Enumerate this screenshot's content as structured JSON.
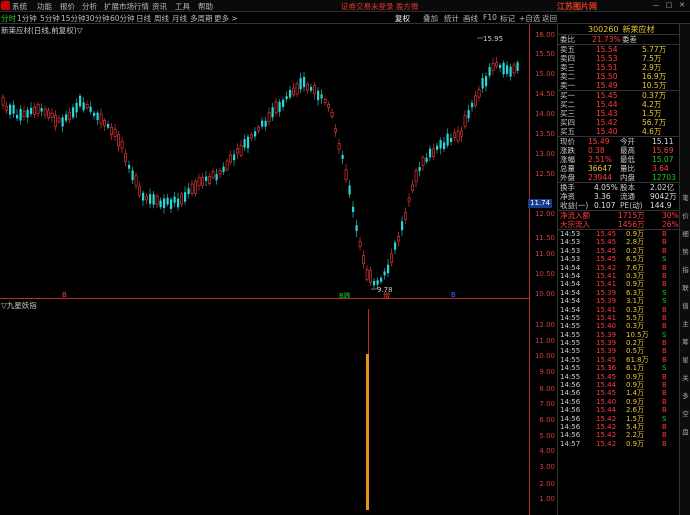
{
  "menu": {
    "items": [
      "系统",
      "功能",
      "报价",
      "分析",
      "扩展市场行情",
      "资讯",
      "工具",
      "帮助"
    ],
    "notice": "证券交易未登录  盈方微",
    "brand": "江苏图片网",
    "window_controls": [
      "—",
      "□",
      "✕"
    ]
  },
  "period_tabs": {
    "items": [
      "分时",
      "1分钟",
      "5分钟",
      "15分钟",
      "30分钟",
      "60分钟",
      "日线",
      "周线",
      "月线",
      "多周期",
      "更多 >"
    ],
    "active_index": 0
  },
  "toolbar": {
    "items": [
      "复权",
      "叠加",
      "统计",
      "画线",
      "F10",
      "标记",
      "+自选",
      "返回"
    ]
  },
  "chart": {
    "title": "新莱应材(日线,前复权)▽",
    "high_label": "15.95",
    "low_label": "9.78",
    "current_price_label": "11.74",
    "markers": [
      {
        "text": "B",
        "color": "#ff3b3b"
      },
      {
        "text": "B跌",
        "color": "#16d016"
      },
      {
        "text": "增",
        "color": "#ff3b3b"
      },
      {
        "text": "B",
        "color": "#3a6cff"
      }
    ]
  },
  "axis": {
    "price_labels": [
      "16.00",
      "15.50",
      "15.00",
      "14.50",
      "14.00",
      "13.50",
      "13.00",
      "12.50",
      "12.00",
      "11.50",
      "11.00",
      "10.50",
      "10.00"
    ],
    "ind_labels": [
      "12.00",
      "11.00",
      "10.00",
      "9.00",
      "8.00",
      "7.00",
      "6.00",
      "5.00",
      "4.00",
      "3.00",
      "2.00",
      "1.00"
    ]
  },
  "indicator": {
    "title": "▽九星妖指"
  },
  "stock": {
    "code": "300260",
    "name": "新莱应材"
  },
  "order_book": {
    "weibi": {
      "label": "委比",
      "value": "21.73%",
      "label2": "委差",
      "value2": ""
    },
    "asks": [
      {
        "label": "卖五",
        "price": "15.54",
        "vol": "5.77万"
      },
      {
        "label": "卖四",
        "price": "15.53",
        "vol": "7.5万"
      },
      {
        "label": "卖三",
        "price": "15.51",
        "vol": "2.9万"
      },
      {
        "label": "卖二",
        "price": "15.50",
        "vol": "16.9万"
      },
      {
        "label": "卖一",
        "price": "15.49",
        "vol": "10.5万"
      }
    ],
    "bids": [
      {
        "label": "买一",
        "price": "15.45",
        "vol": "0.37万"
      },
      {
        "label": "买二",
        "price": "15.44",
        "vol": "4.2万"
      },
      {
        "label": "买三",
        "price": "15.43",
        "vol": "1.5万"
      },
      {
        "label": "买四",
        "price": "15.42",
        "vol": "56.7万"
      },
      {
        "label": "买五",
        "price": "15.40",
        "vol": "4.6万"
      }
    ]
  },
  "quote": [
    {
      "l1": "现价",
      "v1": "15.49",
      "c1": "red",
      "l2": "今开",
      "v2": "15.11",
      "c2": "wht"
    },
    {
      "l1": "涨跌",
      "v1": "0.38",
      "c1": "red",
      "l2": "最高",
      "v2": "15.69",
      "c2": "red"
    },
    {
      "l1": "涨幅",
      "v1": "2.51%",
      "c1": "red",
      "l2": "最低",
      "v2": "15.07",
      "c2": "grn"
    },
    {
      "l1": "总量",
      "v1": "36647",
      "c1": "yel",
      "l2": "量比",
      "v2": "3.64",
      "c2": "red"
    },
    {
      "l1": "外盘",
      "v1": "23944",
      "c1": "red",
      "l2": "内盘",
      "v2": "12703",
      "c2": "grn"
    }
  ],
  "stats": [
    {
      "l1": "换手",
      "v1": "4.05%",
      "c1": "wht",
      "l2": "股本",
      "v2": "2.02亿",
      "c2": "wht"
    },
    {
      "l1": "净资",
      "v1": "3.36",
      "c1": "wht",
      "l2": "流通",
      "v2": "9042万",
      "c2": "wht"
    },
    {
      "l1": "收益(一)",
      "v1": "0.107",
      "c1": "wht",
      "l2": "PE(动)",
      "v2": "144.9",
      "c2": "wht"
    }
  ],
  "flows": [
    {
      "label": "净流入额",
      "value": "1715万",
      "pct": "30%"
    },
    {
      "label": "大宗流入",
      "value": "1456万",
      "pct": "26%"
    }
  ],
  "ticks": [
    {
      "t": "14:53",
      "p": "15.45",
      "v": "0.9万",
      "d": "B"
    },
    {
      "t": "14:53",
      "p": "15.45",
      "v": "2.8万",
      "d": "B"
    },
    {
      "t": "14:53",
      "p": "15.45",
      "v": "0.2万",
      "d": "B"
    },
    {
      "t": "14:53",
      "p": "15.45",
      "v": "6.5万",
      "d": "S"
    },
    {
      "t": "14:54",
      "p": "15.42",
      "v": "7.6万",
      "d": "B"
    },
    {
      "t": "14:54",
      "p": "15.41",
      "v": "0.3万",
      "d": "B"
    },
    {
      "t": "14:54",
      "p": "15.41",
      "v": "0.9万",
      "d": "B"
    },
    {
      "t": "14:54",
      "p": "15.39",
      "v": "6.3万",
      "d": "S"
    },
    {
      "t": "14:54",
      "p": "15.39",
      "v": "3.1万",
      "d": "S"
    },
    {
      "t": "14:54",
      "p": "15.41",
      "v": "0.3万",
      "d": "B"
    },
    {
      "t": "14:55",
      "p": "15.41",
      "v": "5.5万",
      "d": "B"
    },
    {
      "t": "14:55",
      "p": "15.40",
      "v": "0.3万",
      "d": "B"
    },
    {
      "t": "14:55",
      "p": "15.39",
      "v": "10.5万",
      "d": "S"
    },
    {
      "t": "14:55",
      "p": "15.39",
      "v": "0.2万",
      "d": "B"
    },
    {
      "t": "14:55",
      "p": "15.39",
      "v": "0.5万",
      "d": "B"
    },
    {
      "t": "14:55",
      "p": "15.45",
      "v": "61.8万",
      "d": "B"
    },
    {
      "t": "14:55",
      "p": "15.36",
      "v": "6.1万",
      "d": "S"
    },
    {
      "t": "14:55",
      "p": "15.45",
      "v": "0.9万",
      "d": "B"
    },
    {
      "t": "14:56",
      "p": "15.44",
      "v": "0.9万",
      "d": "B"
    },
    {
      "t": "14:56",
      "p": "15.45",
      "v": "1.4万",
      "d": "B"
    },
    {
      "t": "14:56",
      "p": "15.40",
      "v": "0.9万",
      "d": "B"
    },
    {
      "t": "14:56",
      "p": "15.44",
      "v": "2.6万",
      "d": "B"
    },
    {
      "t": "14:56",
      "p": "15.42",
      "v": "1.5万",
      "d": "S"
    },
    {
      "t": "14:56",
      "p": "15.42",
      "v": "5.4万",
      "d": "B"
    },
    {
      "t": "14:56",
      "p": "15.42",
      "v": "2.2万",
      "d": "B"
    },
    {
      "t": "14:57",
      "p": "15.42",
      "v": "0.9万",
      "d": "B"
    }
  ],
  "vtabs": [
    "笔",
    "价",
    "细",
    "势",
    "指",
    "联",
    "值",
    "主",
    "筹",
    "星",
    "关",
    "多",
    "空",
    "盘"
  ]
}
